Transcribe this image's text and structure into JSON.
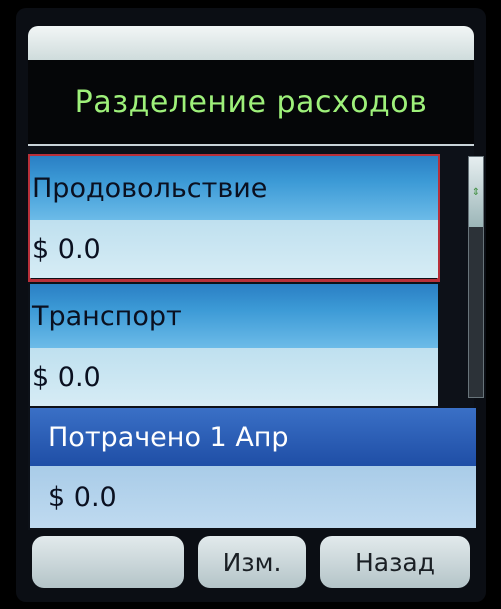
{
  "header": {
    "title": "Разделение расходов"
  },
  "items": [
    {
      "label": "Продовольствие",
      "value": "$ 0.0"
    },
    {
      "label": "Транспорт",
      "value": "$ 0.0"
    },
    {
      "label": "Потрачено 1 Апр",
      "value": "$ 0.0"
    }
  ],
  "softkeys": {
    "left": "",
    "middle": "Изм.",
    "right": "Назад"
  },
  "colors": {
    "title_text": "#9ef07a",
    "selection_border": "#b8303a",
    "item_header": "#3c9ad6",
    "focus_header": "#1f4ea6"
  },
  "icons": {
    "scroll_indicator": "scroll-arrows-icon"
  }
}
